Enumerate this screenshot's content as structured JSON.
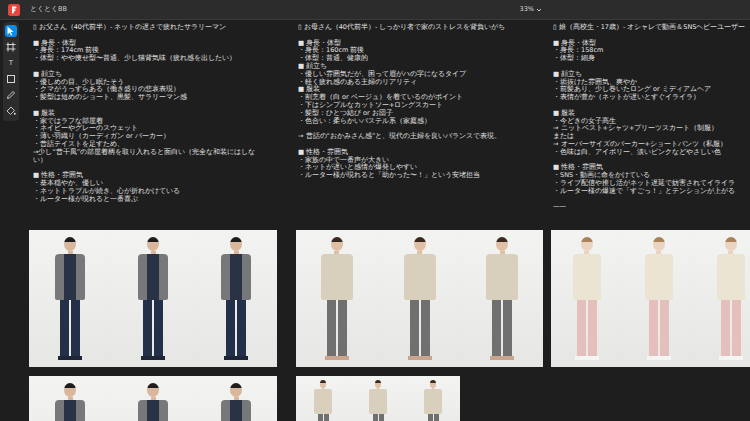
{
  "window": {
    "title": "とくとくBB",
    "zoom": "33%"
  },
  "tools": [
    {
      "kind": "move",
      "selected": true
    },
    {
      "kind": "frame",
      "selected": false
    },
    {
      "kind": "text",
      "glyph": "T",
      "selected": false
    },
    {
      "kind": "shape",
      "selected": false
    },
    {
      "kind": "pen",
      "selected": false
    },
    {
      "kind": "fill",
      "selected": false
    }
  ],
  "notes": [
    {
      "title": "▯ お父さん（40代前半）- ネットの遅さで疲れたサラリーマン",
      "blocks": [
        [
          "■ 身長・体型",
          "・身長：174cm 前後",
          "・体型：やや痩せ型〜普通、少し猫背気味（疲れ感を出したい）"
        ],
        [
          "■ 顔立ち",
          "・優しめの目、少し眠たそう",
          "・クマがうっすらある（働き盛りの悲哀表現）",
          "・髪型は短めのショート、黒髪、サラリーマン感"
        ],
        [
          "■ 服装",
          "・家ではラフな部屋着",
          "・ネイビーやグレーのスウェット",
          "・薄い羽織り（カーディガン or パーカー）",
          "・昔話テイストを足すため、",
          "→少し“昔干風”の部屋着柄を取り入れると面白い（完全な和装にはしない）"
        ],
        [
          "■ 性格・雰囲気",
          "・基本穏やか、優しい",
          "・ネットトラブルが続き、心が折れかけている",
          "・ルーター様が現れると一番喜ぶ"
        ]
      ]
    },
    {
      "title": "▯ お母さん（40代前半）- しっかり者で家のストレスを背負いがち",
      "blocks": [
        [
          "■ 身長・体型",
          "・身長：160cm 前後",
          "・体型：普通、健康的",
          "■ 顔立ち",
          "・優しい雰囲気だが、困って眉がハの字になるタイプ",
          "・軽く疲れ感のある主婦のリアリティ",
          "■ 服装",
          "・割烹着（白 or ベージュ）を着ているのがポイント",
          "・下はシンプルなカットソー+ロングスカート",
          "・髪型：ひとつ結び or お団子",
          "・色合い：柔らかいパステル系（家庭感）"
        ],
        [
          "→ 昔話の“おかみさん感”と、現代の主婦を良いバランスで表現。"
        ],
        [
          "■ 性格・雰囲気",
          "・家族の中で一番声が大きい",
          "・ネットが遅いと感情が爆発しやすい",
          "・ルーター様が現れると「助かった〜！」という安堵担当"
        ]
      ]
    },
    {
      "title": "▯ 娘（高校生・17歳）- オシャレで動画＆SNSヘビーユーザー",
      "blocks": [
        [
          "■ 身長・体型",
          "・身長：158cm",
          "・体型：細身"
        ],
        [
          "■ 顔立ち",
          "・垢抜けた雰囲気、爽やか",
          "・前髪あり、少し巻いたロング or ミディアムヘア",
          "・表情が豊か（ネットが遅いとすぐイライラ）"
        ],
        [
          "■ 服装",
          "・今どきの女子高生",
          "→ ニットベスト+シャツ+プリーツスカート（制服）",
          "または",
          "→ オーバーサイズのパーカー+ショートパンツ（私服）",
          "・色味は白、アイボリー、淡いピンクなどやさしい色"
        ],
        [
          "■ 性格・雰囲気",
          "・SNS・動画に命をかけている",
          "・ライブ配信や推し活がネット遅延で妨害されてイライラ",
          "・ルーター様の爆速で「すごっ！」とテンションが上がる"
        ],
        [
          "——"
        ]
      ]
    }
  ]
}
